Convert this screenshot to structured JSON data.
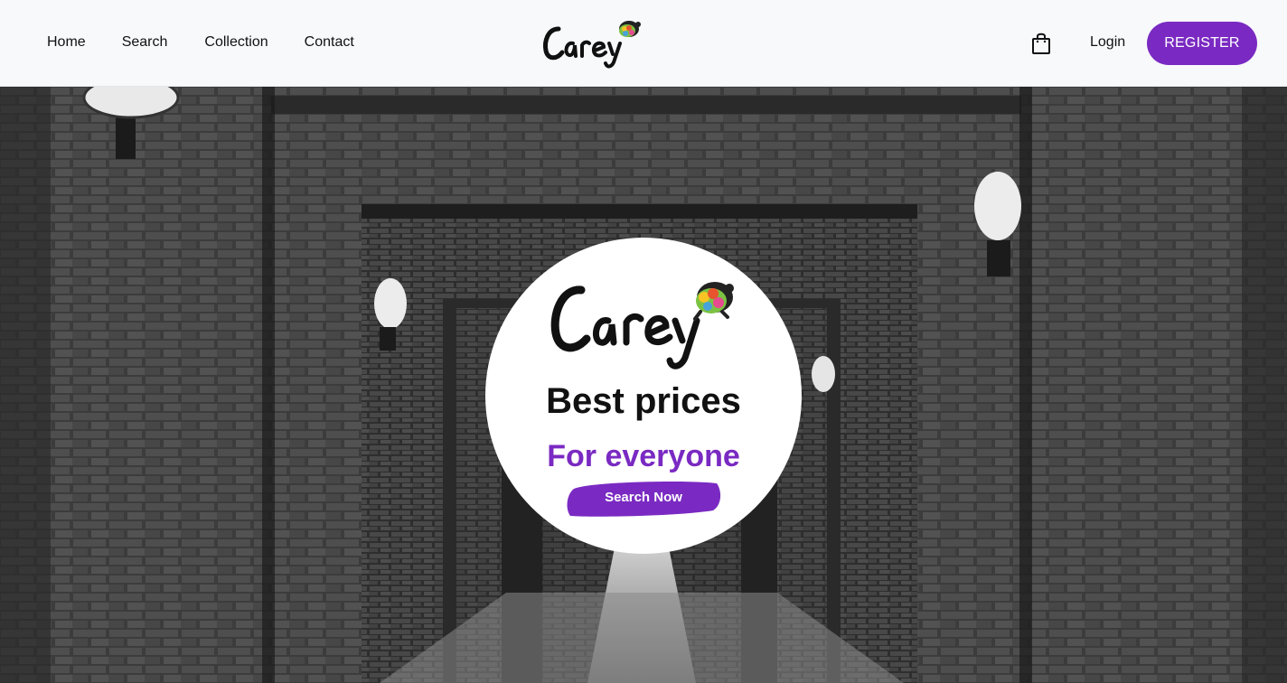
{
  "nav": {
    "links": [
      "Home",
      "Search",
      "Collection",
      "Contact"
    ],
    "login": "Login",
    "register": "REGISTER"
  },
  "brand": {
    "logo_icon": "carey-logo-with-rainbow-turtle"
  },
  "hero": {
    "headline": "Best prices",
    "subheadline": "For everyone",
    "cta": "Search Now",
    "background": "black-and-white-brick-corridor-photo"
  },
  "icons": {
    "cart": "shopping-bag-icon"
  },
  "colors": {
    "accent": "#7a2ac2",
    "navbar_bg": "#f8f9fb",
    "text": "#111111"
  }
}
